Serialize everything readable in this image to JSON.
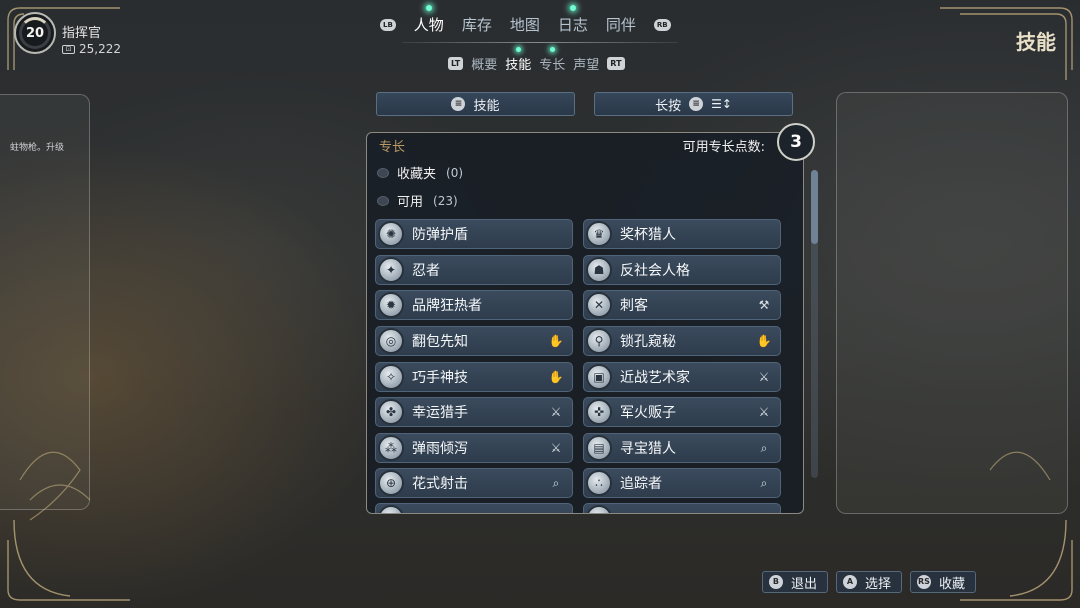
{
  "profile": {
    "level": "20",
    "name": "指挥官",
    "currency": "25,222",
    "currency_icon": "credits-icon"
  },
  "topnav": {
    "left_bumper": "LB",
    "right_bumper": "RB",
    "tabs": [
      {
        "label": "人物",
        "active": true,
        "notify": true
      },
      {
        "label": "库存",
        "active": false,
        "notify": false
      },
      {
        "label": "地图",
        "active": false,
        "notify": false
      },
      {
        "label": "日志",
        "active": false,
        "notify": true
      },
      {
        "label": "同伴",
        "active": false,
        "notify": false
      }
    ]
  },
  "subnav": {
    "left_trigger": "LT",
    "right_trigger": "RT",
    "tabs": [
      {
        "label": "概要",
        "active": false,
        "notify": false
      },
      {
        "label": "技能",
        "active": true,
        "notify": true
      },
      {
        "label": "专长",
        "active": false,
        "notify": true
      },
      {
        "label": "声望",
        "active": false,
        "notify": false
      }
    ]
  },
  "screen_title": "技能",
  "filters": {
    "left_label": "技能",
    "right_label": "长按",
    "right_icon": "menu-sort-icon"
  },
  "left_panel_text": "蛀物枪。升级",
  "panel": {
    "title": "专长",
    "points_label": "可用专长点数:",
    "points_value": "3",
    "categories": [
      {
        "label": "收藏夹",
        "count": "(0)"
      },
      {
        "label": "可用",
        "count": "(23)"
      }
    ],
    "perks": [
      {
        "label": "防弹护盾",
        "icon": "shield-burst-icon",
        "tag": ""
      },
      {
        "label": "奖杯猎人",
        "icon": "trophy-icon",
        "tag": ""
      },
      {
        "label": "忍者",
        "icon": "ninja-icon",
        "tag": ""
      },
      {
        "label": "反社会人格",
        "icon": "mask-icon",
        "tag": ""
      },
      {
        "label": "品牌狂热者",
        "icon": "badge-icon",
        "tag": ""
      },
      {
        "label": "刺客",
        "icon": "crossed-blades-icon",
        "tag": "tool-icon"
      },
      {
        "label": "翻包先知",
        "icon": "eye-bag-icon",
        "tag": "hand-icon"
      },
      {
        "label": "锁孔窥秘",
        "icon": "keyhole-icon",
        "tag": "hand-icon"
      },
      {
        "label": "巧手神技",
        "icon": "hand-skill-icon",
        "tag": "hand-icon"
      },
      {
        "label": "近战艺术家",
        "icon": "melee-icon",
        "tag": "knife-icon"
      },
      {
        "label": "幸运猎手",
        "icon": "clover-icon",
        "tag": "knife-icon"
      },
      {
        "label": "军火贩子",
        "icon": "gun-icon",
        "tag": "knife-icon"
      },
      {
        "label": "弹雨倾泻",
        "icon": "bullets-icon",
        "tag": "knife-icon"
      },
      {
        "label": "寻宝猎人",
        "icon": "chest-icon",
        "tag": "search-icon"
      },
      {
        "label": "花式射击",
        "icon": "target-icon",
        "tag": "search-icon"
      },
      {
        "label": "追踪者",
        "icon": "tracks-icon",
        "tag": "search-icon"
      }
    ]
  },
  "hints": [
    {
      "button": "B",
      "label": "退出"
    },
    {
      "button": "A",
      "label": "选择"
    },
    {
      "button": "RS",
      "label": "收藏"
    }
  ]
}
